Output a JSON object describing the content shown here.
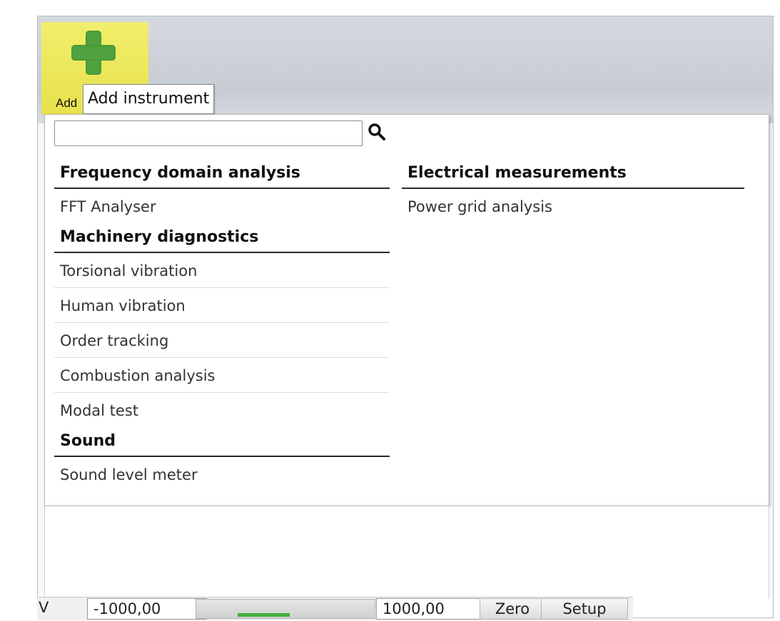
{
  "toolbar": {
    "add_button_label": "Add",
    "tooltip": "Add instrument"
  },
  "search": {
    "value": "",
    "placeholder": ""
  },
  "menu": {
    "left_column": [
      {
        "header": "Frequency domain analysis",
        "items": [
          "FFT Analyser"
        ]
      },
      {
        "header": "Machinery diagnostics",
        "items": [
          "Torsional vibration",
          "Human vibration",
          "Order tracking",
          "Combustion analysis",
          "Modal test"
        ]
      },
      {
        "header": "Sound",
        "items": [
          "Sound level meter"
        ]
      }
    ],
    "right_column": [
      {
        "header": "Electrical measurements",
        "items": [
          "Power grid analysis"
        ]
      }
    ]
  },
  "status_bar": {
    "unit": "V",
    "min": "-1000,00",
    "max": "1000,00",
    "level_fraction": 0.45,
    "zero_label": "Zero",
    "setup_label": "Setup"
  },
  "colors": {
    "add_button": "#e7e14c",
    "plus_icon": "#4fa23d",
    "ribbon": "#c7ccd3",
    "level_bar": "#3fae3a"
  },
  "icons": {
    "add": "plus-icon",
    "search": "search-icon"
  }
}
